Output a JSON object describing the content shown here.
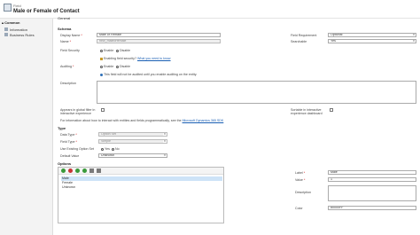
{
  "header": {
    "breadcrumb": "Field",
    "title": "Male or Female of Contact"
  },
  "leftnav": {
    "section": "Common",
    "items": [
      {
        "label": "Information"
      },
      {
        "label": "Business Rules"
      }
    ]
  },
  "main": {
    "tab": "General",
    "schema_header": "Schema",
    "display_name": {
      "label": "Display Name",
      "value": "Male or Female"
    },
    "field_requirement": {
      "label": "Field Requirement",
      "value": "Optional"
    },
    "name": {
      "label": "Name",
      "value": "new_maleorfemale"
    },
    "searchable": {
      "label": "Searchable",
      "value": "Yes"
    },
    "field_security": {
      "label": "Field Security",
      "opt1": "Enable",
      "opt2": "Disable",
      "selected": "Disable"
    },
    "security_hint": {
      "text": "Enabling field security?",
      "link": "What you need to know"
    },
    "auditing": {
      "label": "Auditing",
      "opt1": "Enable",
      "opt2": "Disable",
      "selected": "Enable"
    },
    "audit_note": "This field will not be audited until you enable auditing on the entity.",
    "description_label": "Description",
    "global_filter_label": "Appears in global filter in interactive experience",
    "sortable_label": "Sortable in interactive experience dashboard",
    "sdk_note": "For information about how to interact with entities and fields programmatically, see the",
    "sdk_link": "Microsoft Dynamics 365 SDK",
    "type_header": "Type",
    "data_type": {
      "label": "Data Type",
      "value": "Option Set"
    },
    "field_type": {
      "label": "Field Type",
      "value": "Simple"
    },
    "use_existing": {
      "label": "Use Existing Option Set",
      "yes": "Yes",
      "no": "No",
      "selected": "No"
    },
    "default_value": {
      "label": "Default Value",
      "value": "Unknown"
    },
    "options_header": "Options"
  },
  "options": {
    "items": [
      "Male",
      "Female",
      "Unknown"
    ],
    "selected_index": 0
  },
  "option_details": {
    "label": {
      "label": "Label",
      "value": "Male"
    },
    "value": {
      "label": "Value",
      "value": "1"
    },
    "description": {
      "label": "Description"
    },
    "color": {
      "label": "Color",
      "value": "#0000FF"
    }
  }
}
